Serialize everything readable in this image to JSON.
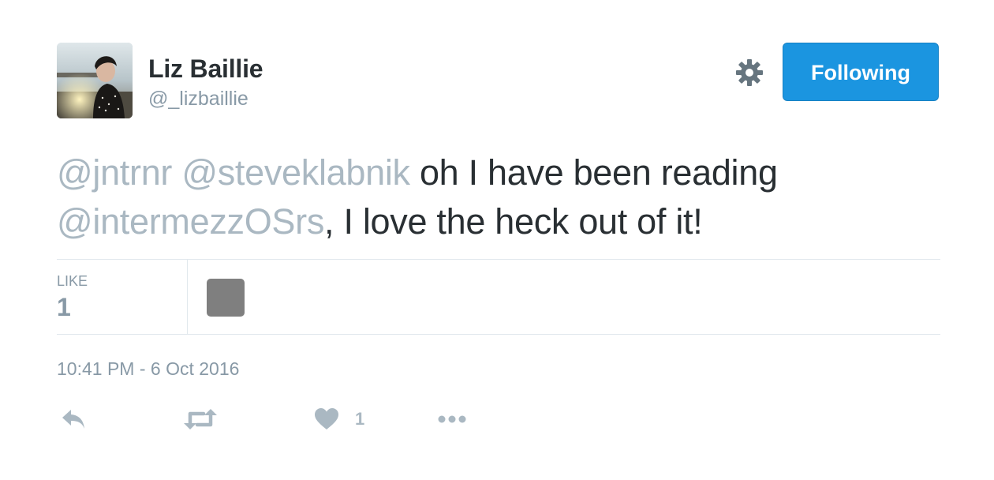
{
  "author": {
    "name": "Liz Baillie",
    "handle": "@_lizbaillie"
  },
  "follow_button": {
    "label": "Following"
  },
  "tweet": {
    "mentions": [
      "@jntrnr",
      "@steveklabnik"
    ],
    "text_part1": "oh I have been reading",
    "mention3": "@intermezzOSrs",
    "text_part2": ", I love the heck out of it!"
  },
  "stats": {
    "like_label": "LIKE",
    "like_count": "1"
  },
  "timestamp": "10:41 PM - 6 Oct 2016",
  "actions": {
    "like_count": "1"
  },
  "icons": {
    "settings": "gear-icon",
    "reply": "reply-icon",
    "retweet": "retweet-icon",
    "like": "heart-icon",
    "more": "more-dots-icon"
  },
  "colors": {
    "accent": "#1b95e0",
    "mention": "#aab8c2",
    "muted": "#8899a6",
    "text": "#292f33",
    "icon": "#aab8c2"
  }
}
